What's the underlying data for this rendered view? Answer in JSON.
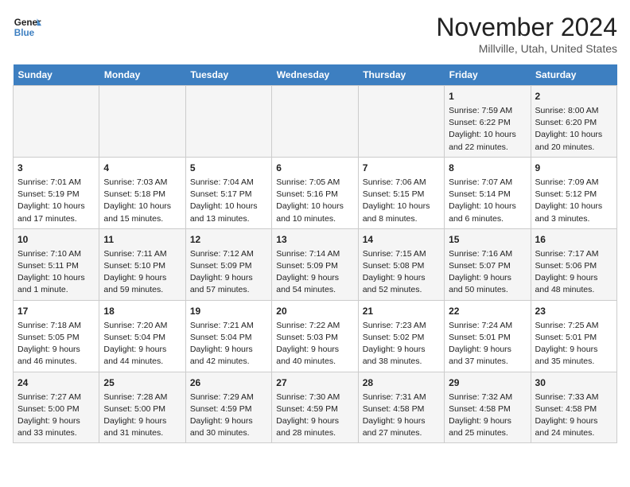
{
  "logo": {
    "line1": "General",
    "line2": "Blue"
  },
  "title": "November 2024",
  "location": "Millville, Utah, United States",
  "days_header": [
    "Sunday",
    "Monday",
    "Tuesday",
    "Wednesday",
    "Thursday",
    "Friday",
    "Saturday"
  ],
  "weeks": [
    [
      {
        "day": "",
        "info": ""
      },
      {
        "day": "",
        "info": ""
      },
      {
        "day": "",
        "info": ""
      },
      {
        "day": "",
        "info": ""
      },
      {
        "day": "",
        "info": ""
      },
      {
        "day": "1",
        "info": "Sunrise: 7:59 AM\nSunset: 6:22 PM\nDaylight: 10 hours\nand 22 minutes."
      },
      {
        "day": "2",
        "info": "Sunrise: 8:00 AM\nSunset: 6:20 PM\nDaylight: 10 hours\nand 20 minutes."
      }
    ],
    [
      {
        "day": "3",
        "info": "Sunrise: 7:01 AM\nSunset: 5:19 PM\nDaylight: 10 hours\nand 17 minutes."
      },
      {
        "day": "4",
        "info": "Sunrise: 7:03 AM\nSunset: 5:18 PM\nDaylight: 10 hours\nand 15 minutes."
      },
      {
        "day": "5",
        "info": "Sunrise: 7:04 AM\nSunset: 5:17 PM\nDaylight: 10 hours\nand 13 minutes."
      },
      {
        "day": "6",
        "info": "Sunrise: 7:05 AM\nSunset: 5:16 PM\nDaylight: 10 hours\nand 10 minutes."
      },
      {
        "day": "7",
        "info": "Sunrise: 7:06 AM\nSunset: 5:15 PM\nDaylight: 10 hours\nand 8 minutes."
      },
      {
        "day": "8",
        "info": "Sunrise: 7:07 AM\nSunset: 5:14 PM\nDaylight: 10 hours\nand 6 minutes."
      },
      {
        "day": "9",
        "info": "Sunrise: 7:09 AM\nSunset: 5:12 PM\nDaylight: 10 hours\nand 3 minutes."
      }
    ],
    [
      {
        "day": "10",
        "info": "Sunrise: 7:10 AM\nSunset: 5:11 PM\nDaylight: 10 hours\nand 1 minute."
      },
      {
        "day": "11",
        "info": "Sunrise: 7:11 AM\nSunset: 5:10 PM\nDaylight: 9 hours\nand 59 minutes."
      },
      {
        "day": "12",
        "info": "Sunrise: 7:12 AM\nSunset: 5:09 PM\nDaylight: 9 hours\nand 57 minutes."
      },
      {
        "day": "13",
        "info": "Sunrise: 7:14 AM\nSunset: 5:09 PM\nDaylight: 9 hours\nand 54 minutes."
      },
      {
        "day": "14",
        "info": "Sunrise: 7:15 AM\nSunset: 5:08 PM\nDaylight: 9 hours\nand 52 minutes."
      },
      {
        "day": "15",
        "info": "Sunrise: 7:16 AM\nSunset: 5:07 PM\nDaylight: 9 hours\nand 50 minutes."
      },
      {
        "day": "16",
        "info": "Sunrise: 7:17 AM\nSunset: 5:06 PM\nDaylight: 9 hours\nand 48 minutes."
      }
    ],
    [
      {
        "day": "17",
        "info": "Sunrise: 7:18 AM\nSunset: 5:05 PM\nDaylight: 9 hours\nand 46 minutes."
      },
      {
        "day": "18",
        "info": "Sunrise: 7:20 AM\nSunset: 5:04 PM\nDaylight: 9 hours\nand 44 minutes."
      },
      {
        "day": "19",
        "info": "Sunrise: 7:21 AM\nSunset: 5:04 PM\nDaylight: 9 hours\nand 42 minutes."
      },
      {
        "day": "20",
        "info": "Sunrise: 7:22 AM\nSunset: 5:03 PM\nDaylight: 9 hours\nand 40 minutes."
      },
      {
        "day": "21",
        "info": "Sunrise: 7:23 AM\nSunset: 5:02 PM\nDaylight: 9 hours\nand 38 minutes."
      },
      {
        "day": "22",
        "info": "Sunrise: 7:24 AM\nSunset: 5:01 PM\nDaylight: 9 hours\nand 37 minutes."
      },
      {
        "day": "23",
        "info": "Sunrise: 7:25 AM\nSunset: 5:01 PM\nDaylight: 9 hours\nand 35 minutes."
      }
    ],
    [
      {
        "day": "24",
        "info": "Sunrise: 7:27 AM\nSunset: 5:00 PM\nDaylight: 9 hours\nand 33 minutes."
      },
      {
        "day": "25",
        "info": "Sunrise: 7:28 AM\nSunset: 5:00 PM\nDaylight: 9 hours\nand 31 minutes."
      },
      {
        "day": "26",
        "info": "Sunrise: 7:29 AM\nSunset: 4:59 PM\nDaylight: 9 hours\nand 30 minutes."
      },
      {
        "day": "27",
        "info": "Sunrise: 7:30 AM\nSunset: 4:59 PM\nDaylight: 9 hours\nand 28 minutes."
      },
      {
        "day": "28",
        "info": "Sunrise: 7:31 AM\nSunset: 4:58 PM\nDaylight: 9 hours\nand 27 minutes."
      },
      {
        "day": "29",
        "info": "Sunrise: 7:32 AM\nSunset: 4:58 PM\nDaylight: 9 hours\nand 25 minutes."
      },
      {
        "day": "30",
        "info": "Sunrise: 7:33 AM\nSunset: 4:58 PM\nDaylight: 9 hours\nand 24 minutes."
      }
    ]
  ]
}
